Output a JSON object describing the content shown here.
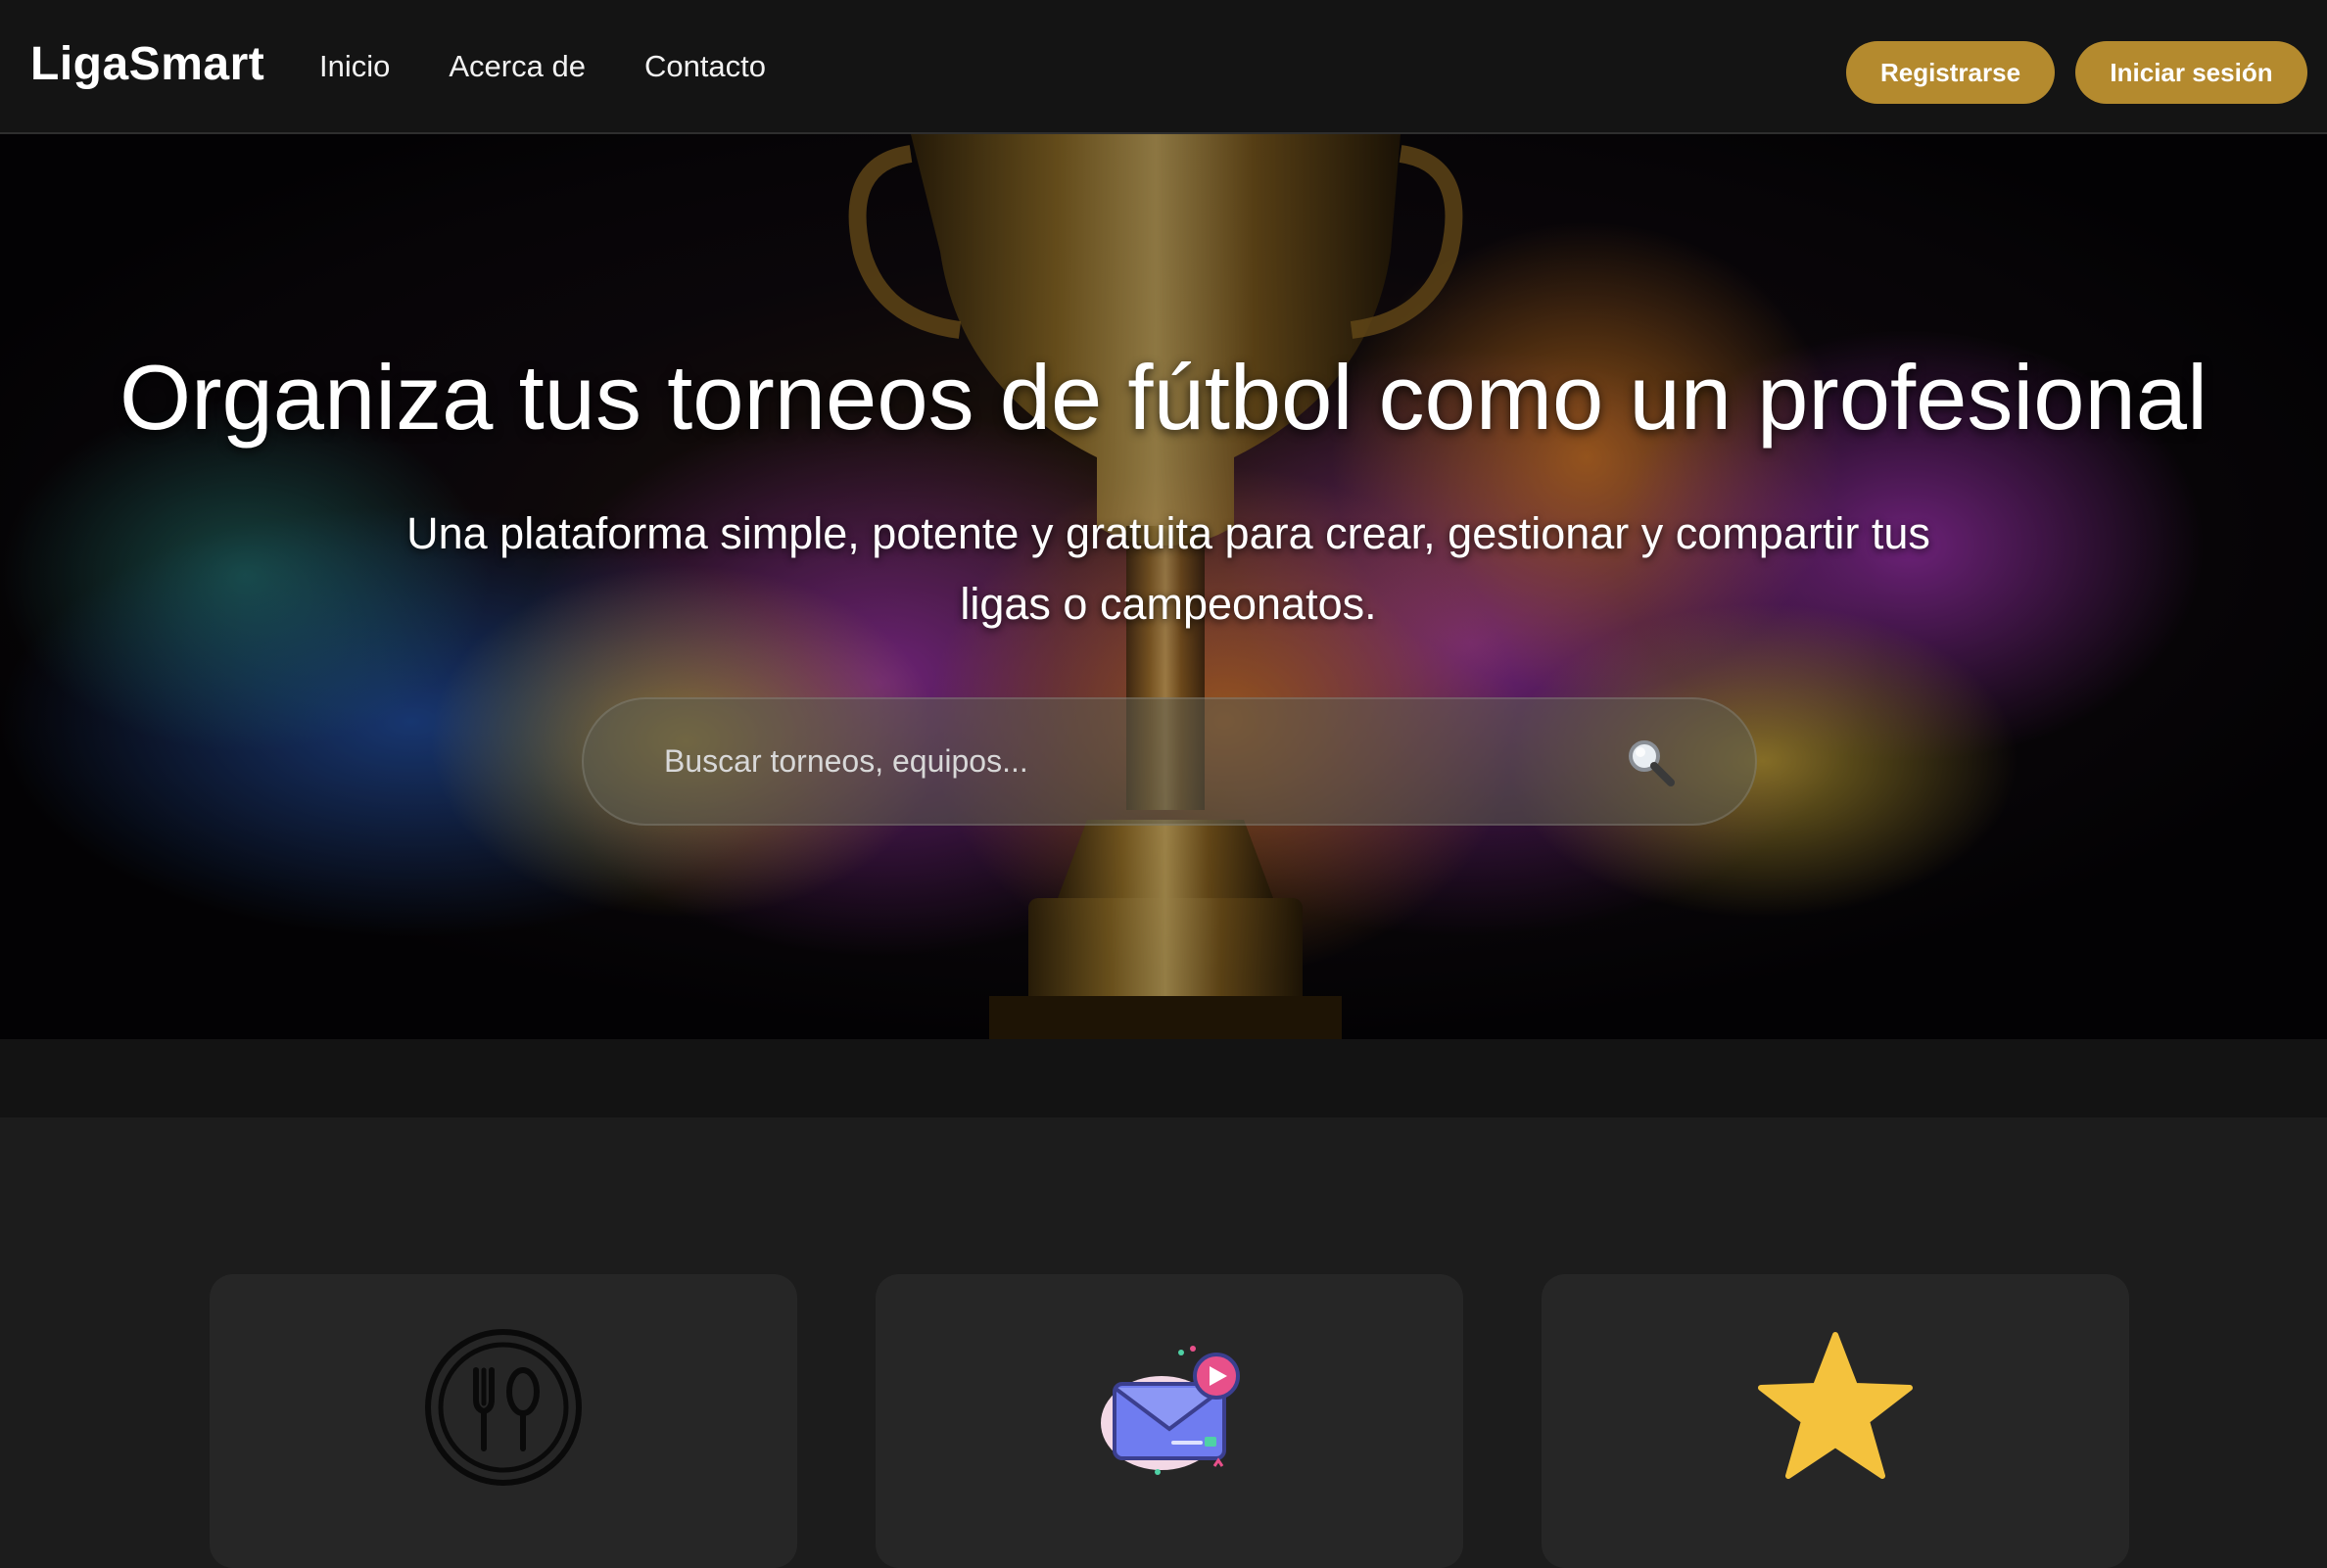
{
  "navbar": {
    "brand": "LigaSmart",
    "links": [
      "Inicio",
      "Acerca de",
      "Contacto"
    ],
    "register_label": "Registrarse",
    "login_label": "Iniciar sesión"
  },
  "hero": {
    "title": "Organiza tus torneos de fútbol como un profesional",
    "subtitle": "Una plataforma simple, potente y gratuita para crear, gestionar y compartir tus ligas o campeonatos.",
    "search": {
      "placeholder": "Buscar torneos, equipos...",
      "value": "",
      "icon": "magnifier-icon"
    },
    "background": "trophy-with-colorful-paint-splash"
  },
  "features": {
    "cards": [
      {
        "icon": "fork-spoon-icon"
      },
      {
        "icon": "envelope-notification-icon"
      },
      {
        "icon": "star-icon"
      }
    ]
  },
  "colors": {
    "nav_bg": "#141414",
    "accent_gold": "#b48a2e",
    "page_bg": "#1c1c1c",
    "card_bg": "#262626",
    "star": "#f4c23d",
    "envelope": "#6f7cf0",
    "badge": "#e8508a"
  }
}
